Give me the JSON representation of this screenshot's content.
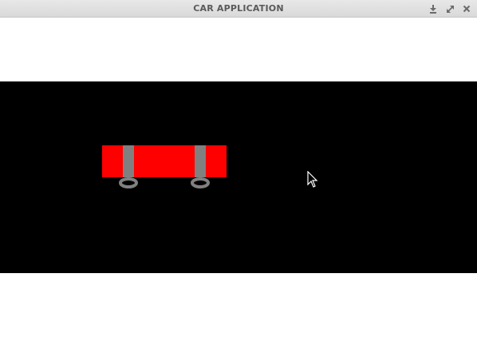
{
  "window": {
    "title": "CAR APPLICATION",
    "controls": {
      "minimize_icon": "download-arrow-icon",
      "maximize_icon": "expand-icon",
      "close_icon": "close-icon"
    }
  },
  "scene": {
    "background_color": "#000000",
    "car": {
      "body_color": "#ff0000",
      "axle_color": "#808080",
      "wheel_color": "#808080",
      "wheel_count": 2
    }
  },
  "cursor": {
    "icon": "arrow-pointer-icon"
  }
}
